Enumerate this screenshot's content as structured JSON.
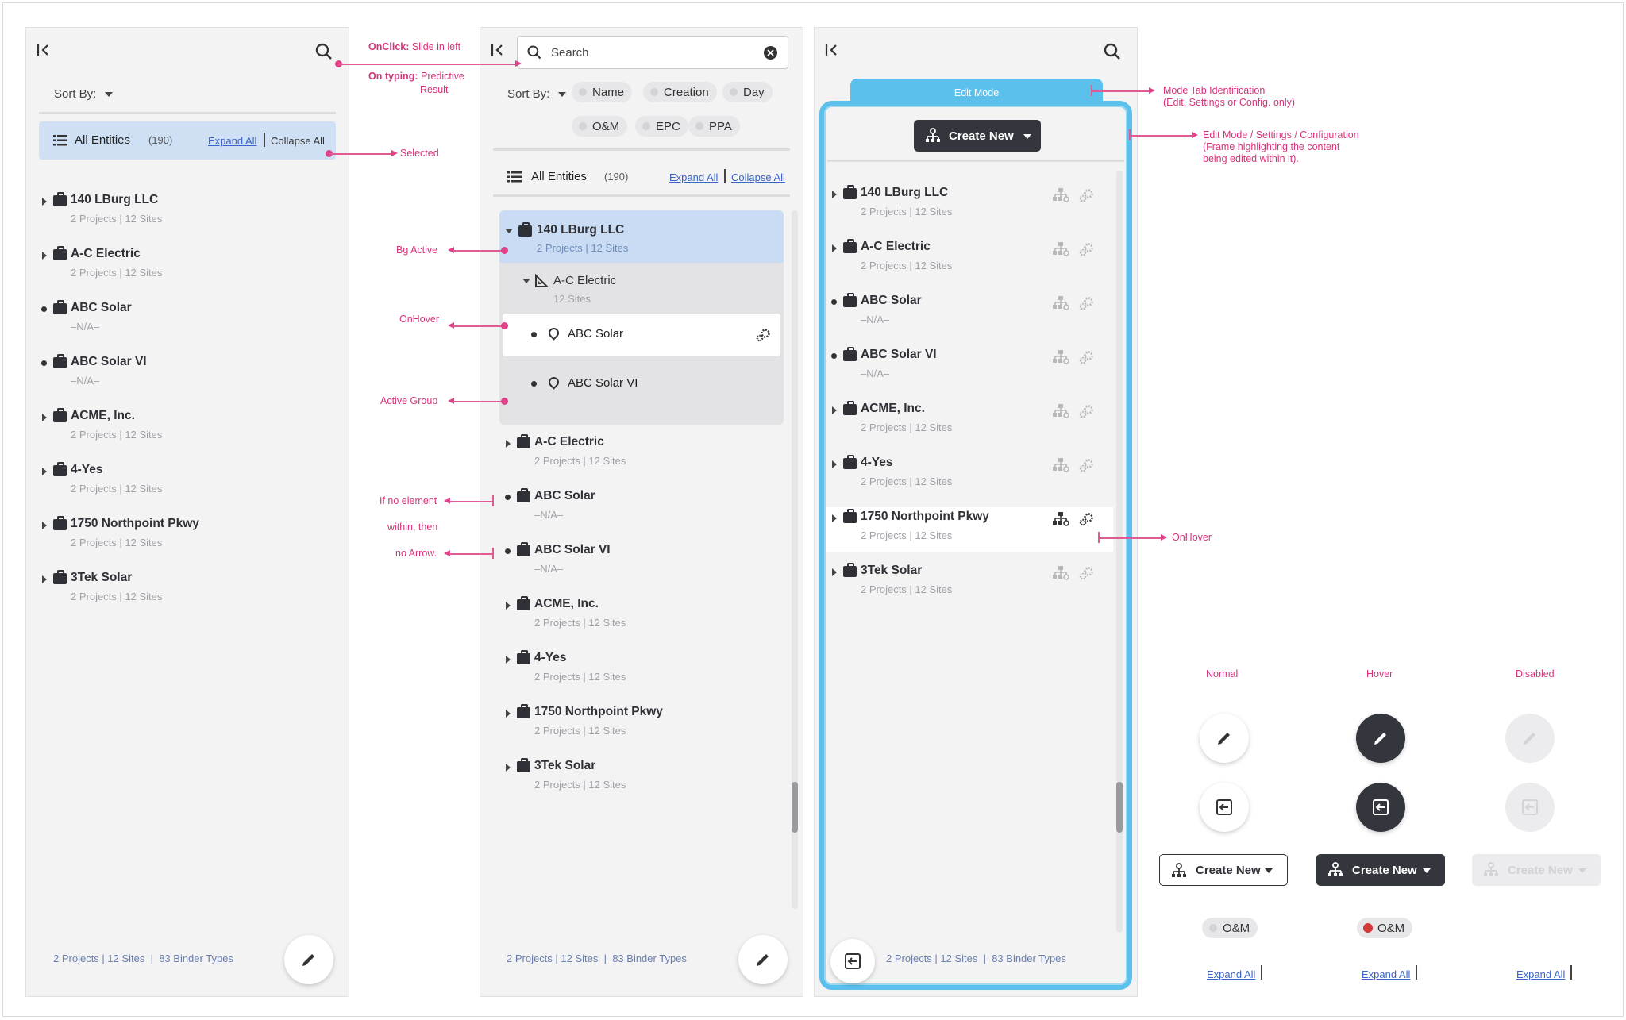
{
  "entities": [
    {
      "name": "140 LBurg LLC",
      "sub": "2 Projects | 12 Sites",
      "arrow": true
    },
    {
      "name": "A-C Electric",
      "sub": "2 Projects | 12 Sites",
      "arrow": true
    },
    {
      "name": "ABC Solar",
      "sub": "–N/A–",
      "arrow": false
    },
    {
      "name": "ABC Solar VI",
      "sub": "–N/A–",
      "arrow": false
    },
    {
      "name": "ACME, Inc.",
      "sub": "2 Projects | 12 Sites",
      "arrow": true
    },
    {
      "name": "4-Yes",
      "sub": "2 Projects | 12 Sites",
      "arrow": true
    },
    {
      "name": "1750 Northpoint Pkwy",
      "sub": "2 Projects | 12 Sites",
      "arrow": true
    },
    {
      "name": "3Tek Solar",
      "sub": "2 Projects | 12 Sites",
      "arrow": true
    }
  ],
  "p1": {
    "sort_label": "Sort By:",
    "all_entities": "All Entities",
    "count": "(190)",
    "expand_all": "Expand All",
    "collapse_all": "Collapse All",
    "footer": "2 Projects | 12 Sites  |  83 Binder Types"
  },
  "p2": {
    "search_placeholder": "Search",
    "sort_label": "Sort By:",
    "chips": [
      "Name",
      "Creation",
      "Day",
      "O&M",
      "EPC",
      "PPA"
    ],
    "all_entities": "All Entities",
    "count": "(190)",
    "expand_all": "Expand All",
    "collapse_all": "Collapse All",
    "active": {
      "name": "140 LBurg LLC",
      "sub": "2 Projects | 12 Sites"
    },
    "group": {
      "name": "A-C Electric",
      "sub": "12 Sites"
    },
    "sites": [
      "ABC Solar",
      "ABC Solar VI"
    ],
    "footer": "2 Projects | 12 Sites  |  83 Binder Types"
  },
  "p3": {
    "tab_label": "Edit Mode",
    "create_new": "Create New",
    "footer": "2 Projects | 12 Sites  |  83 Binder Types"
  },
  "annotations": {
    "onclick_b": "OnClick:",
    "onclick": "Slide in left",
    "ontyping_b": "On typing:",
    "ontyping": "Predictive",
    "ontyping2": "Result",
    "selected": "Selected",
    "bg_active": "Bg Active",
    "onhover": "OnHover",
    "active_group": "Active Group",
    "noelem1": "If no element",
    "noelem2": "within, then",
    "noelem3": "no Arrow.",
    "mode_tab1": "Mode Tab Identification",
    "mode_tab2": "(Edit, Settings or Config. only)",
    "frame1": "Edit Mode / Settings / Configuration",
    "frame2": "(Frame highlighting the content",
    "frame3": "being edited within it).",
    "onhover2": "OnHover"
  },
  "states": {
    "normal": "Normal",
    "hover": "Hover",
    "disabled": "Disabled",
    "create_new": "Create New",
    "om": "O&M",
    "expand_all": "Expand All"
  },
  "colors": {
    "accent": "#5bc0eb",
    "annotation": "#d6337b",
    "active_bg": "#c9dcf3",
    "dark": "#33363d"
  }
}
